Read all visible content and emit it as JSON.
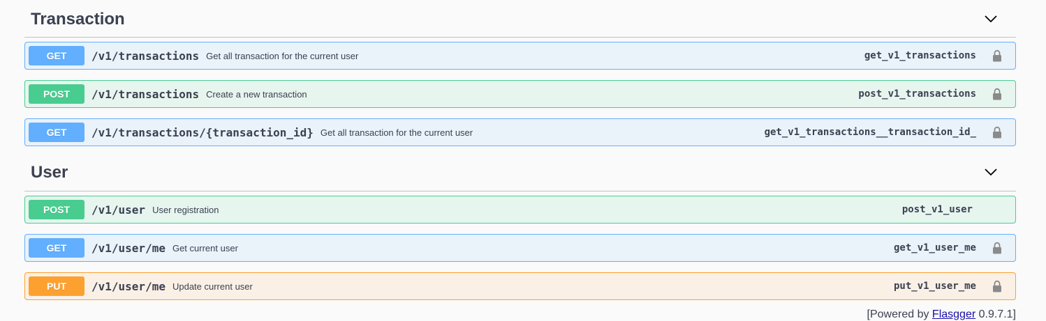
{
  "sections": [
    {
      "title": "Transaction",
      "operations": [
        {
          "method": "GET",
          "path": "/v1/transactions",
          "summary": "Get all transaction for the current user",
          "operation_id": "get_v1_transactions",
          "locked": true
        },
        {
          "method": "POST",
          "path": "/v1/transactions",
          "summary": "Create a new transaction",
          "operation_id": "post_v1_transactions",
          "locked": true
        },
        {
          "method": "GET",
          "path": "/v1/transactions/{transaction_id}",
          "summary": "Get all transaction for the current user",
          "operation_id": "get_v1_transactions__transaction_id_",
          "locked": true
        }
      ]
    },
    {
      "title": "User",
      "operations": [
        {
          "method": "POST",
          "path": "/v1/user",
          "summary": "User registration",
          "operation_id": "post_v1_user",
          "locked": false
        },
        {
          "method": "GET",
          "path": "/v1/user/me",
          "summary": "Get current user",
          "operation_id": "get_v1_user_me",
          "locked": true
        },
        {
          "method": "PUT",
          "path": "/v1/user/me",
          "summary": "Update current user",
          "operation_id": "put_v1_user_me",
          "locked": true
        }
      ]
    }
  ],
  "footer": {
    "prefix": "[Powered by ",
    "link": "Flasgger",
    "suffix": " 0.9.7.1]"
  },
  "icons": {
    "chevron": "chevron-down-icon",
    "lock": "lock-icon"
  },
  "colors": {
    "get": "#61affe",
    "post": "#49cc90",
    "put": "#fca130"
  }
}
